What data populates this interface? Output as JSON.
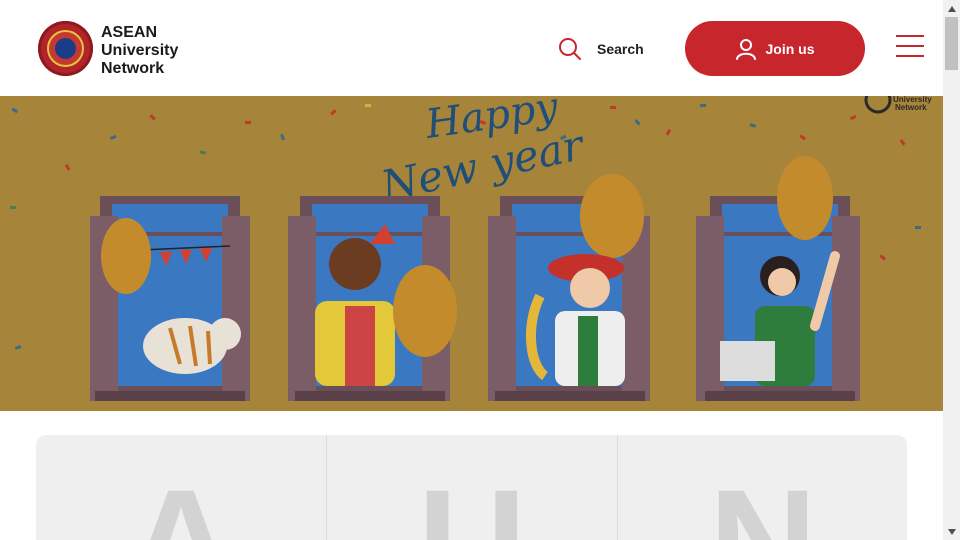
{
  "header": {
    "logo": {
      "line1": "ASEAN",
      "line2": "University",
      "line3": "Network"
    },
    "search": {
      "label": "Search",
      "icon": "search-icon"
    },
    "join": {
      "label": "Join us",
      "icon": "user-icon"
    },
    "menu": {
      "icon": "hamburger-menu-icon"
    }
  },
  "hero": {
    "greeting_line1": "Happy",
    "greeting_line2": "New year",
    "corner_mark_line1": "University",
    "corner_mark_line2": "Network"
  },
  "cards": [
    {
      "letter": "A"
    },
    {
      "letter": "U"
    },
    {
      "letter": "N"
    }
  ],
  "colors": {
    "brand_red": "#c8262d",
    "hero_background": "#a6843a",
    "card_background": "#efefef"
  }
}
